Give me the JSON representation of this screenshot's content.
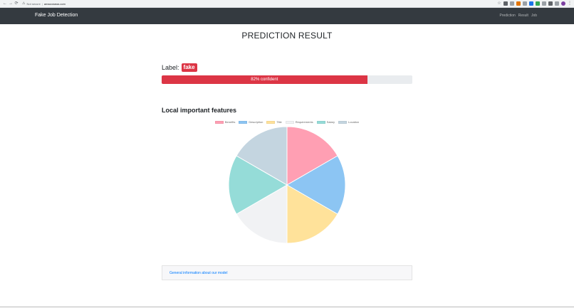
{
  "browser": {
    "nav_back": "←",
    "nav_forward": "→",
    "nav_reload": "⟳",
    "security_icon": "warning-triangle-icon",
    "security_text": "Not secure",
    "separator": "|",
    "url": "amazonaws.com"
  },
  "navbar": {
    "brand": "Fake Job Detection",
    "links": [
      "Prediction",
      "Result",
      "Job"
    ]
  },
  "main": {
    "title": "PREDICTION RESULT",
    "label_prefix": "Label:",
    "label_value": "fake",
    "label_color": "#dc3545",
    "confidence_fraction": 0.82,
    "confidence_text": "82% confident",
    "features_title": "Local important features",
    "info_link": "General information about our model"
  },
  "chart_data": {
    "type": "pie",
    "categories": [
      "Benefits",
      "Description",
      "Title",
      "Requirements",
      "Salary",
      "Location"
    ],
    "values": [
      1,
      1,
      1,
      1,
      1,
      1
    ],
    "colors": [
      "#ff9fb3",
      "#8cc5f3",
      "#ffe29a",
      "#f1f2f4",
      "#95dcd8",
      "#c4d5e0"
    ],
    "legend_position": "top"
  },
  "colors": {
    "navbar_bg": "#343a40",
    "danger": "#dc3545",
    "link": "#007bff"
  }
}
